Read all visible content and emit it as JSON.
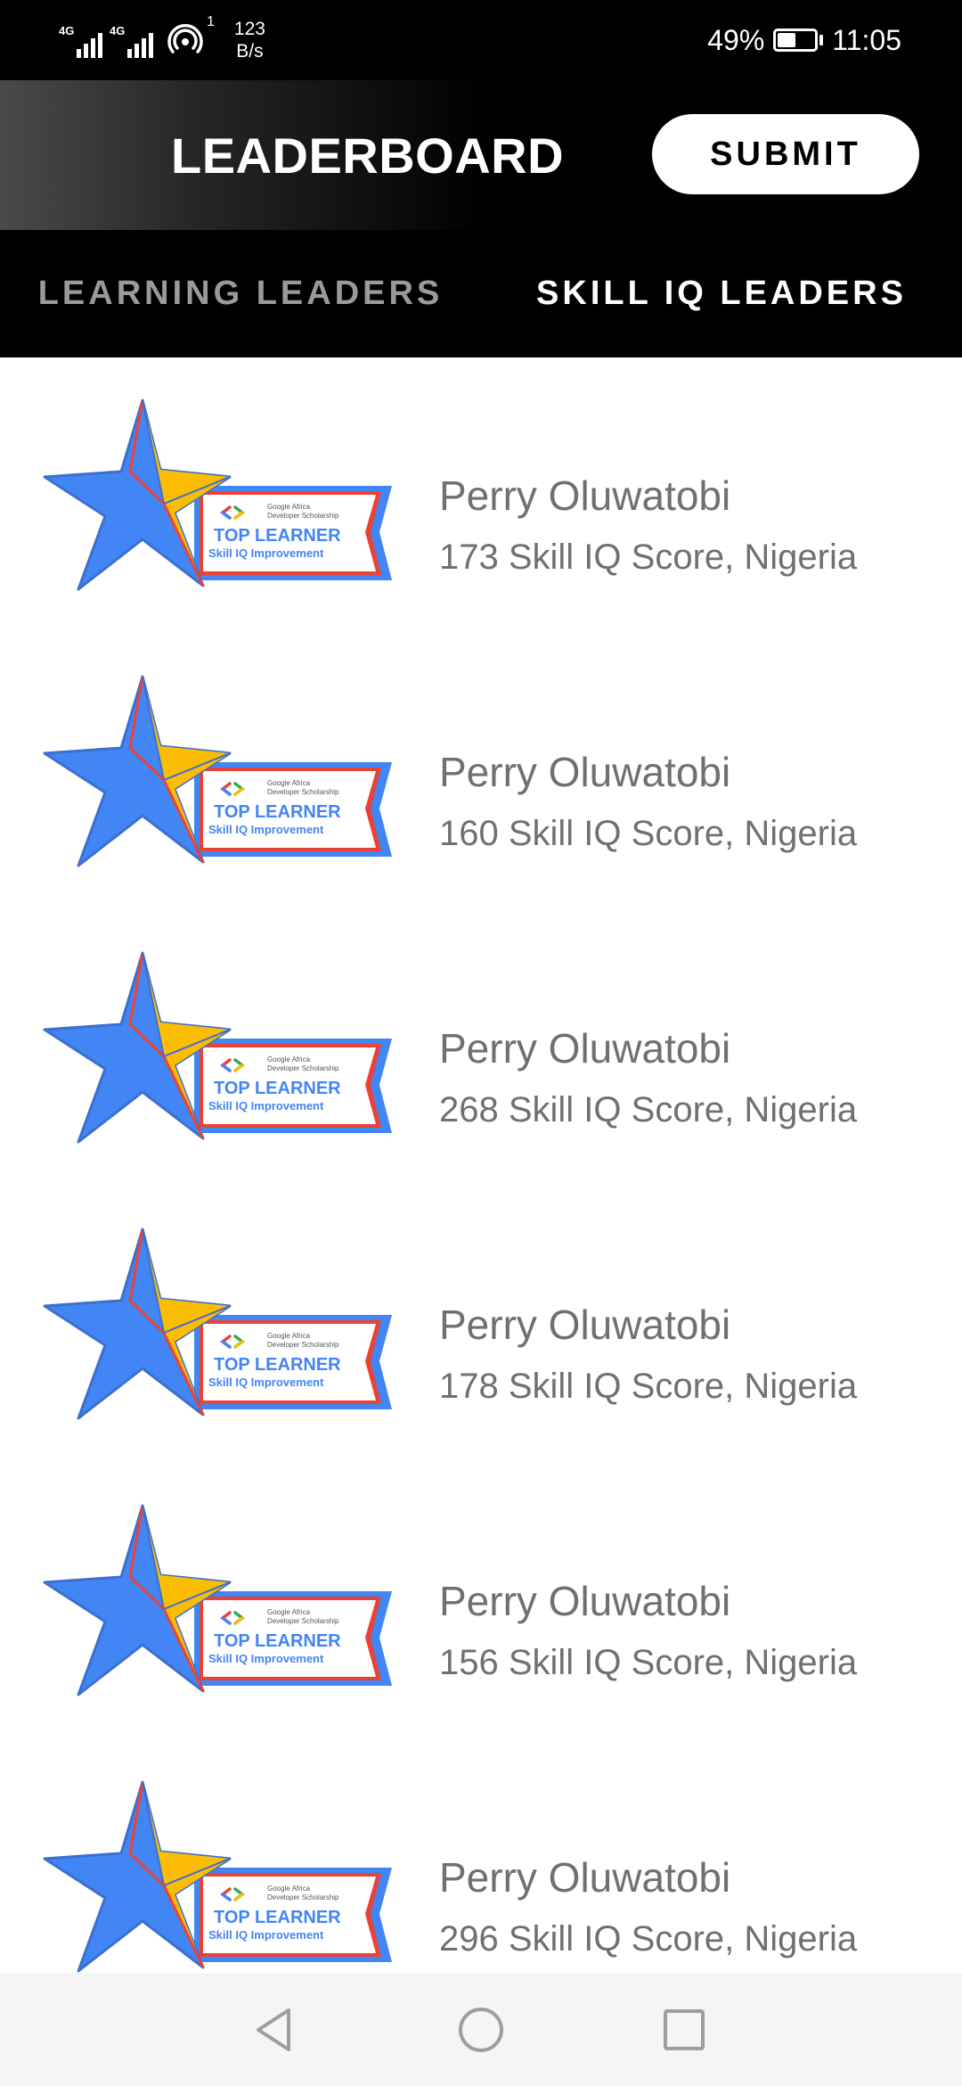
{
  "status_bar": {
    "signal1_tag": "4G",
    "signal2_tag": "4G",
    "hotspot_count": "1",
    "speed_value": "123",
    "speed_unit": "B/s",
    "battery_percent": "49%",
    "battery_level": 0.49,
    "time": "11:05",
    "icons": [
      "signal-icon",
      "signal-icon",
      "hotspot-icon",
      "battery-charging-icon"
    ]
  },
  "header": {
    "title": "LEADERBOARD",
    "submit_label": "SUBMIT"
  },
  "tabs": [
    {
      "label": "LEARNING LEADERS",
      "selected": false
    },
    {
      "label": "SKILL IQ LEADERS",
      "selected": true
    }
  ],
  "badge": {
    "brand_line1": "Google Africa",
    "brand_line2": "Developer Scholarship",
    "title": "TOP LEARNER",
    "subtitle": "Skill IQ Improvement",
    "colors": {
      "star": "#4285F4",
      "star_accent": "#FBBC04",
      "ribbon_border": "#EA4335",
      "text": "#4285F4"
    }
  },
  "leaders": [
    {
      "name": "Perry Oluwatobi",
      "detail": "173 Skill IQ Score, Nigeria"
    },
    {
      "name": "Perry Oluwatobi",
      "detail": "160 Skill IQ Score, Nigeria"
    },
    {
      "name": "Perry Oluwatobi",
      "detail": "268 Skill IQ Score, Nigeria"
    },
    {
      "name": "Perry Oluwatobi",
      "detail": "178 Skill IQ Score, Nigeria"
    },
    {
      "name": "Perry Oluwatobi",
      "detail": "156 Skill IQ Score, Nigeria"
    },
    {
      "name": "Perry Oluwatobi",
      "detail": "296 Skill IQ Score, Nigeria"
    }
  ],
  "nav_bar": {
    "icons": [
      "back-icon",
      "home-icon",
      "recents-icon"
    ]
  }
}
